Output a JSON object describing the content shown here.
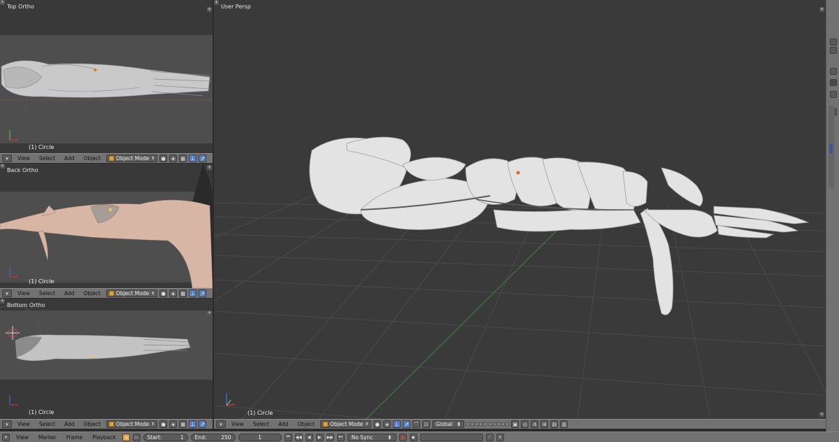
{
  "viewports": {
    "top": {
      "title": "Top Ortho",
      "object": "(1) Circle"
    },
    "back": {
      "title": "Back Ortho",
      "object": "(1) Circle"
    },
    "bottom": {
      "title": "Bottom Ortho",
      "object": "(1) Circle"
    },
    "main": {
      "title": "User Persp",
      "object": "(1) Circle"
    }
  },
  "header": {
    "menu_view": "View",
    "menu_select": "Select",
    "menu_add": "Add",
    "menu_object": "Object",
    "mode": "Object Mode",
    "orientation": "Global"
  },
  "timeline": {
    "menu_view": "View",
    "menu_marker": "Marker",
    "menu_frame": "Frame",
    "menu_playback": "Playback",
    "start_label": "Start:",
    "start_value": "1",
    "end_label": "End:",
    "end_value": "250",
    "current_frame": "1",
    "sync": "No Sync"
  },
  "colors": {
    "viewport_bg": "#393939",
    "header_bg": "#727272",
    "mesh": "#d8d8d8",
    "mesh_skin": "#d9b8a8",
    "accent_blue": "#5680c2",
    "object_mode_icon": "#e5a43b"
  }
}
